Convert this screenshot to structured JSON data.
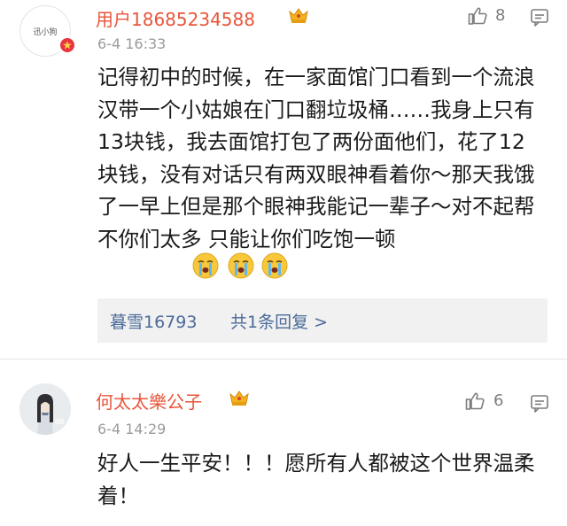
{
  "comments": [
    {
      "username": "用户18685234588",
      "avatar_text": "迅小狗",
      "time": "6-4 16:33",
      "likes": "8",
      "body": "记得初中的时候，在一家面馆门口看到一个流浪汉带一个小姑娘在门口翻垃圾桶……我身上只有13块钱，我去面馆打包了两份面他们，花了12块钱，没有对话只有两双眼神看着你～那天我饿了一早上但是那个眼神我能记一辈子～对不起帮不你们太多 只能让你们吃饱一顿",
      "reply_user": "暮雪16793",
      "reply_count": "共1条回复 >",
      "verified_badge": "red-v-badge",
      "crown_icon": "member-crown-icon",
      "emoji_icon": "crying-face-emoji"
    },
    {
      "username": "何太太樂公子",
      "time": "6-4 14:29",
      "likes": "6",
      "body": "好人一生平安！！！愿所有人都被这个世界温柔着！",
      "crown_icon": "member-crown-icon"
    }
  ],
  "colors": {
    "username": "#e8553a",
    "reply_link": "#4a6a98",
    "meta": "#9b9b9b",
    "reply_bg": "#f1f1f1",
    "badge": "#e8343d"
  }
}
